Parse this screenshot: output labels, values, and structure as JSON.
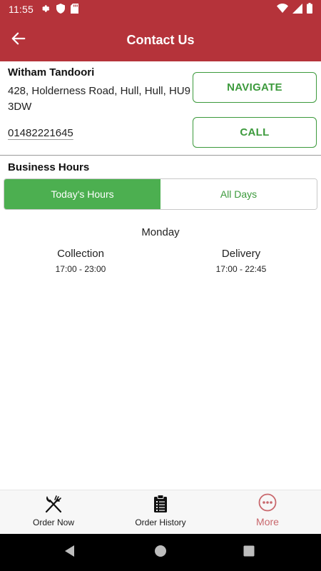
{
  "status_bar": {
    "time": "11:55",
    "icons": [
      "gear-icon",
      "shield-icon",
      "sd-card-icon",
      "wifi-icon",
      "signal-icon",
      "battery-icon"
    ]
  },
  "app_bar": {
    "title": "Contact Us",
    "back_icon": "arrow-left-icon"
  },
  "restaurant": {
    "name": "Witham Tandoori",
    "address": "428, Holderness Road, Hull, Hull, HU9 3DW",
    "phone": "01482221645"
  },
  "actions": {
    "navigate_label": "NAVIGATE",
    "call_label": "CALL"
  },
  "hours": {
    "title": "Business Hours",
    "tabs": [
      "Today's Hours",
      "All Days"
    ],
    "selected_tab": "Today's Hours",
    "day": "Monday",
    "collection": {
      "label": "Collection",
      "time": "17:00 - 23:00"
    },
    "delivery": {
      "label": "Delivery",
      "time": "17:00 - 22:45"
    }
  },
  "bottom_nav": {
    "items": [
      {
        "label": "Order Now",
        "icon": "fork-knife-icon"
      },
      {
        "label": "Order History",
        "icon": "clipboard-icon"
      },
      {
        "label": "More",
        "icon": "more-dots-icon"
      }
    ]
  },
  "colors": {
    "brand": "#b5333a",
    "accent_green": "#4caf50",
    "button_green": "#3c9a3c",
    "more_active": "#c9686d"
  }
}
